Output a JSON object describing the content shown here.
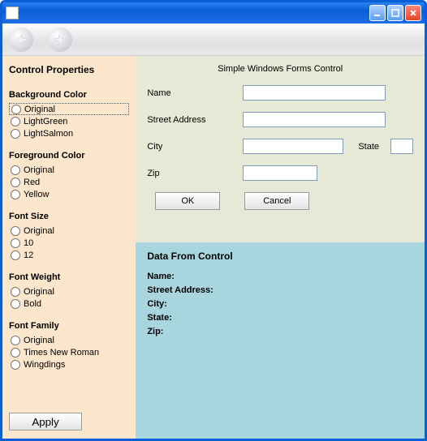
{
  "window": {
    "title": ""
  },
  "sidebar": {
    "heading": "Control Properties",
    "groups": {
      "bg": {
        "title": "Background Color",
        "options": [
          "Original",
          "LightGreen",
          "LightSalmon"
        ],
        "selected": 0
      },
      "fg": {
        "title": "Foreground Color",
        "options": [
          "Original",
          "Red",
          "Yellow"
        ],
        "selected": -1
      },
      "size": {
        "title": "Font Size",
        "options": [
          "Original",
          "10",
          "12"
        ],
        "selected": -1
      },
      "weight": {
        "title": "Font Weight",
        "options": [
          "Original",
          "Bold"
        ],
        "selected": -1
      },
      "family": {
        "title": "Font Family",
        "options": [
          "Original",
          "Times New Roman",
          "Wingdings"
        ],
        "selected": -1
      }
    },
    "apply_label": "Apply"
  },
  "form": {
    "title": "Simple Windows Forms Control",
    "labels": {
      "name": "Name",
      "street": "Street Address",
      "city": "City",
      "state": "State",
      "zip": "Zip"
    },
    "values": {
      "name": "",
      "street": "",
      "city": "",
      "state": "",
      "zip": ""
    },
    "ok_label": "OK",
    "cancel_label": "Cancel"
  },
  "data": {
    "heading": "Data From Control",
    "labels": {
      "name": "Name:",
      "street": "Street Address:",
      "city": "City:",
      "state": "State:",
      "zip": "Zip:"
    },
    "values": {
      "name": "",
      "street": "",
      "city": "",
      "state": "",
      "zip": ""
    }
  }
}
